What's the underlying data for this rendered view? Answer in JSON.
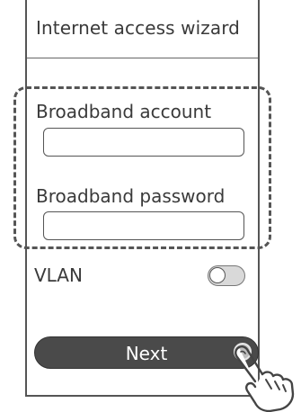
{
  "header": {
    "title": "Internet access wizard"
  },
  "form": {
    "account_label": "Broadband account",
    "account_value": "",
    "password_label": "Broadband password",
    "password_value": ""
  },
  "vlan": {
    "label": "VLAN",
    "enabled": false
  },
  "actions": {
    "next_label": "Next"
  },
  "icons": {
    "hand": "pointing-hand-icon"
  },
  "colors": {
    "button_bg": "#4a4a4a",
    "toggle_off": "#d9d9d9"
  }
}
